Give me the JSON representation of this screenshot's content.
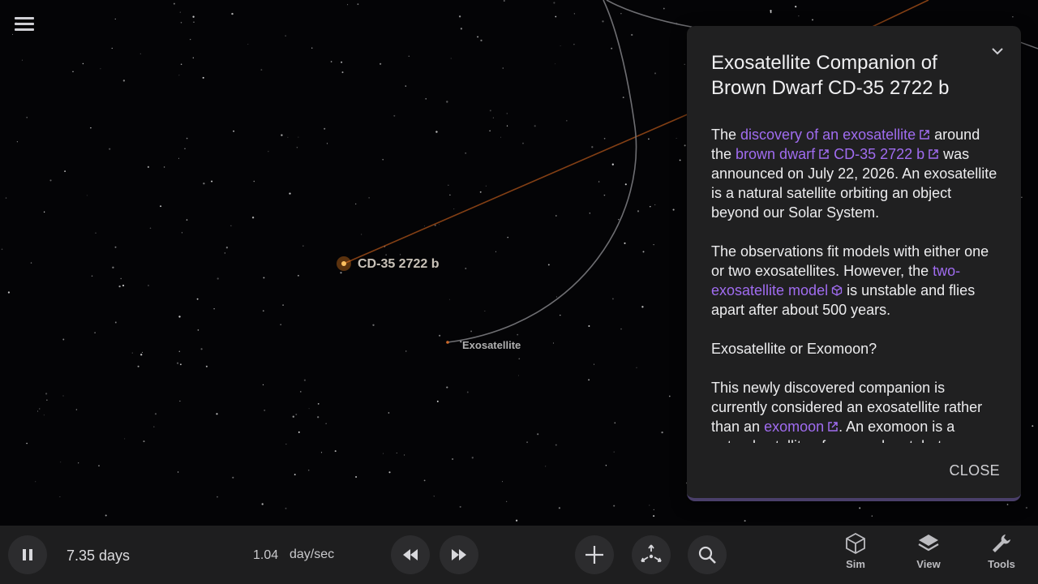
{
  "app": {
    "menu_icon": "hamburger-menu-icon"
  },
  "scene": {
    "primary_label": "CD-35 2722 b",
    "secondary_label": "Exosatellite"
  },
  "panel": {
    "title": "Exosatellite Companion of Brown Dwarf CD-35 2722 b",
    "p1": {
      "t1": "The ",
      "link1": "discovery of an exosatellite",
      "t2": " around the ",
      "link2": "brown dwarf",
      "t3": " ",
      "link3": "CD-35 2722 b",
      "t4": " was announced on July 22, 2026. An exosatellite is a natural satellite orbiting an object beyond our Solar System."
    },
    "p2": {
      "t1": "The observations fit models with either one or two exosatellites. However, the ",
      "link1": "two-exosatellite model",
      "t2": " is unstable and flies apart after about 500 years."
    },
    "p3": {
      "heading": "Exosatellite or Exomoon?"
    },
    "p4": {
      "t1": "This newly discovered companion is currently considered an exosatellite rather than an ",
      "link1": "exomoon",
      "t2": ". An exomoon is a natural satellite of an exoplanet, but"
    },
    "close_label": "CLOSE",
    "link_color": "#a06cf0"
  },
  "toolbar": {
    "elapsed": "7.35 days",
    "rate_value": "1.04",
    "rate_unit": "day/sec",
    "nav": [
      {
        "label": "Sim",
        "icon": "cube-icon"
      },
      {
        "label": "View",
        "icon": "layers-icon"
      },
      {
        "label": "Tools",
        "icon": "wrench-icon"
      }
    ]
  },
  "colors": {
    "background": "#040406",
    "panel": "#202021",
    "accent": "#a06cf0",
    "orbit_primary": "#b35a1f",
    "orbit_secondary": "#6e6e72"
  }
}
